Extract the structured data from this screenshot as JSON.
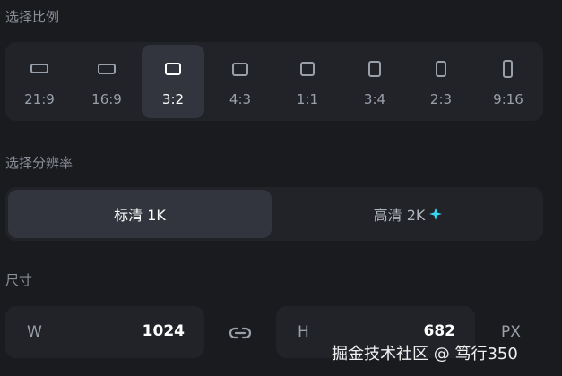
{
  "ratio_section": {
    "title": "选择比例",
    "items": [
      {
        "label": "21:9",
        "selected": false
      },
      {
        "label": "16:9",
        "selected": false
      },
      {
        "label": "3:2",
        "selected": true
      },
      {
        "label": "4:3",
        "selected": false
      },
      {
        "label": "1:1",
        "selected": false
      },
      {
        "label": "3:4",
        "selected": false
      },
      {
        "label": "2:3",
        "selected": false
      },
      {
        "label": "9:16",
        "selected": false
      }
    ]
  },
  "resolution_section": {
    "title": "选择分辨率",
    "options": [
      {
        "label": "标清 1K",
        "selected": true
      },
      {
        "label": "高清 2K",
        "selected": false,
        "icon": "sparkle-icon"
      }
    ]
  },
  "size_section": {
    "title": "尺寸",
    "width": {
      "letter": "W",
      "value": "1024"
    },
    "height": {
      "letter": "H",
      "value": "682"
    },
    "link_icon": "link-icon",
    "unit": "PX"
  },
  "watermark": "掘金技术社区 @ 笃行350",
  "colors": {
    "background": "#1a1b1f",
    "panel": "#212328",
    "selected": "#32353d",
    "sparkle": "#37d5f0"
  }
}
